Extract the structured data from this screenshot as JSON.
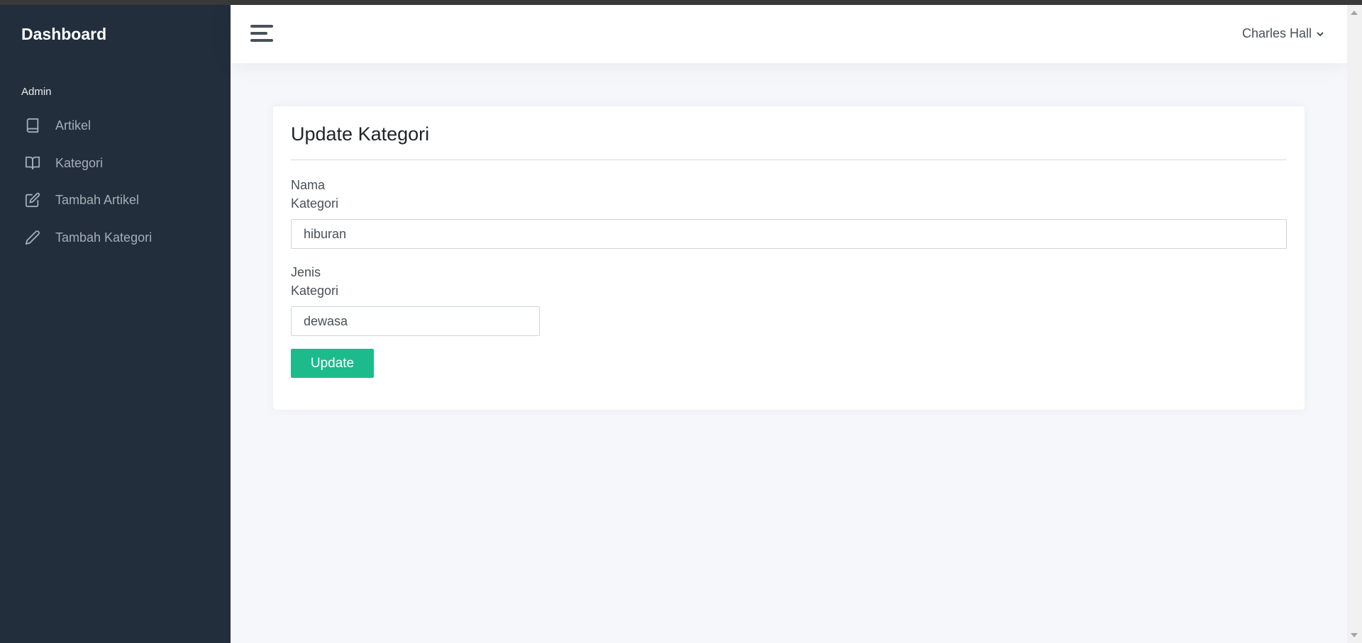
{
  "sidebar": {
    "brand": "Dashboard",
    "header": "Admin",
    "items": [
      {
        "label": "Artikel",
        "icon": "book-icon"
      },
      {
        "label": "Kategori",
        "icon": "book-open-icon"
      },
      {
        "label": "Tambah Artikel",
        "icon": "edit-icon"
      },
      {
        "label": "Tambah Kategori",
        "icon": "pencil-icon"
      }
    ]
  },
  "navbar": {
    "user_name": "Charles Hall"
  },
  "form": {
    "title": "Update Kategori",
    "nama_label_line1": "Nama",
    "nama_label_line2": "Kategori",
    "nama_value": "hiburan",
    "jenis_label_line1": "Jenis",
    "jenis_label_line2": "Kategori",
    "jenis_value": "dewasa",
    "submit_label": "Update"
  },
  "colors": {
    "sidebar_bg": "#222e3c",
    "primary_button": "#1cbb8c",
    "page_bg": "#f5f7fb"
  }
}
